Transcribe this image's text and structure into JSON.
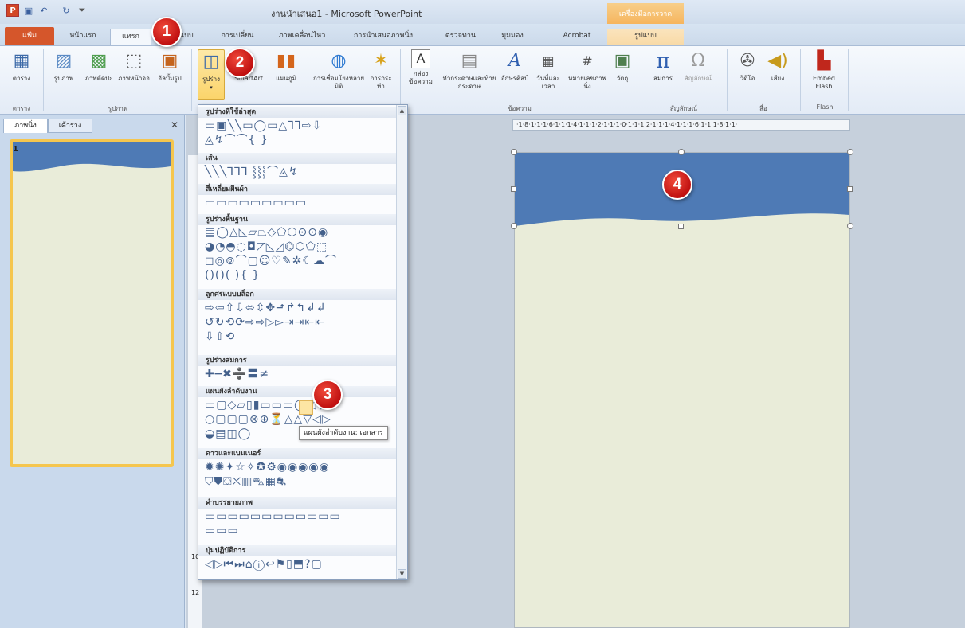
{
  "titlebar": {
    "app_icon": "P",
    "window_title": "งานนำเสนอ1  -  Microsoft PowerPoint",
    "context_group": "เครื่องมือการวาด"
  },
  "tabs": [
    {
      "label": "แฟ้ม"
    },
    {
      "label": "หน้าแรก"
    },
    {
      "label": "แทรก"
    },
    {
      "label": "ออกแบบ"
    },
    {
      "label": "การเปลี่ยน"
    },
    {
      "label": "ภาพเคลื่อนไหว"
    },
    {
      "label": "การนำเสนอภาพนิ่ง"
    },
    {
      "label": "ตรวจทาน"
    },
    {
      "label": "มุมมอง"
    },
    {
      "label": "Acrobat"
    }
  ],
  "context_tab": "รูปแบบ",
  "ribbon": {
    "buttons": [
      {
        "label": "ตาราง",
        "icon": "table-icon"
      },
      {
        "label": "รูปภาพ",
        "icon": "picture-icon"
      },
      {
        "label": "ภาพตัดปะ",
        "icon": "clipart-icon"
      },
      {
        "label": "ภาพหน้าจอ",
        "icon": "screenshot-icon"
      },
      {
        "label": "อัลบั้มรูป",
        "icon": "photo-album-icon"
      },
      {
        "label": "รูปร่าง",
        "icon": "shapes-icon"
      },
      {
        "label": "SmartArt",
        "icon": "smartart-icon"
      },
      {
        "label": "แผนภูมิ",
        "icon": "chart-icon"
      },
      {
        "label": "การเชื่อมโยงหลายมิติ",
        "icon": "hyperlink-icon"
      },
      {
        "label": "การกระทำ",
        "icon": "action-icon"
      },
      {
        "label": "กล่องข้อความ",
        "icon": "textbox-icon"
      },
      {
        "label": "หัวกระดาษและท้ายกระดาษ",
        "icon": "header-footer-icon"
      },
      {
        "label": "อักษรศิลป์",
        "icon": "wordart-icon"
      },
      {
        "label": "วันที่และเวลา",
        "icon": "date-time-icon"
      },
      {
        "label": "หมายเลขภาพนิ่ง",
        "icon": "slide-number-icon"
      },
      {
        "label": "วัตถุ",
        "icon": "object-icon"
      },
      {
        "label": "สมการ",
        "icon": "equation-icon"
      },
      {
        "label": "สัญลักษณ์",
        "icon": "symbol-icon"
      },
      {
        "label": "วิดีโอ",
        "icon": "video-icon"
      },
      {
        "label": "เสียง",
        "icon": "audio-icon"
      },
      {
        "label": "Embed Flash",
        "icon": "flash-icon"
      }
    ],
    "groups": [
      "ตาราง",
      "รูปภาพ",
      "ข้อความ",
      "สัญลักษณ์",
      "สื่อ",
      "Flash"
    ]
  },
  "left_panel": {
    "tab_slides": "ภาพนิ่ง",
    "tab_outline": "เค้าร่าง",
    "slide_number": "1"
  },
  "shapes_menu": {
    "categories": [
      "รูปร่างที่ใช้ล่าสุด",
      "เส้น",
      "สี่เหลี่ยมผืนผ้า",
      "รูปร่างพื้นฐาน",
      "ลูกศรแบบบล็อก",
      "รูปร่างสมการ",
      "แผนผังลำดับงาน",
      "ดาวและแบนเนอร์",
      "คำบรรยายภาพ",
      "ปุ่มปฏิบัติการ"
    ],
    "rows": [
      "▭▣╲╲▭◯▭△⅂⅂⇨⇩",
      "◬↯⌒⌒{ }",
      "╲╲╲⅂⅂⅂ ⸾⸾⸾⌒◬↯",
      "▭▭▭▭▭▭▭▭▭",
      "▤◯△◺▱⏢◇⬠⬡⊙⊙◉",
      "◕◔◓◌◘◸◺◿⌬⬡⬠⬚",
      "◻◎⊚⌒▢☺♡✎✲☾☁⌒",
      "()()( ){ }",
      "⇨⇦⇧⇩⬄⇳✥⬏↱↰↲↲",
      "↺↻⟲⟳⇨⇨▷▻⇥⇥⇤⇤",
      "⇩⇧⟲",
      "✚━✖➗〓≠",
      "▭▢◇▱▯▮▭▭▭◯◁▽",
      "○▢▢▢⊗⊕⏳△△▽◁▷",
      "◒▤◫◯",
      "✹✺✦☆✧✪⚙◉◉◉◉◉",
      "⛉⛊⛋⛌▥⛍▦⛐",
      "▭▭▭▭▭▭▭▭▭▭▭▭",
      "▭▭▭",
      "◁▷⏮⏭⌂ⓘ↩⚑▯⬒?▢"
    ],
    "tooltip": "แผนผังลำดับงาน: เอกสาร"
  },
  "ruler": {
    "horizontal": "·1·8·1·1·1·6·1·1·1·4·1·1·1·2·1·1·1·0·1·1·1·2·1·1·1·4·1·1·1·6·1·1·1·8·1·1·",
    "vertical_marks": [
      "12",
      "10"
    ]
  },
  "badges": [
    "1",
    "2",
    "3",
    "4"
  ],
  "colors": {
    "file_tab": "#d5562b",
    "slide_band": "#4e7ab5",
    "slide_bg": "#e9ecd9",
    "thumb_border": "#f5c64e",
    "badge_red": "#d01a10"
  }
}
